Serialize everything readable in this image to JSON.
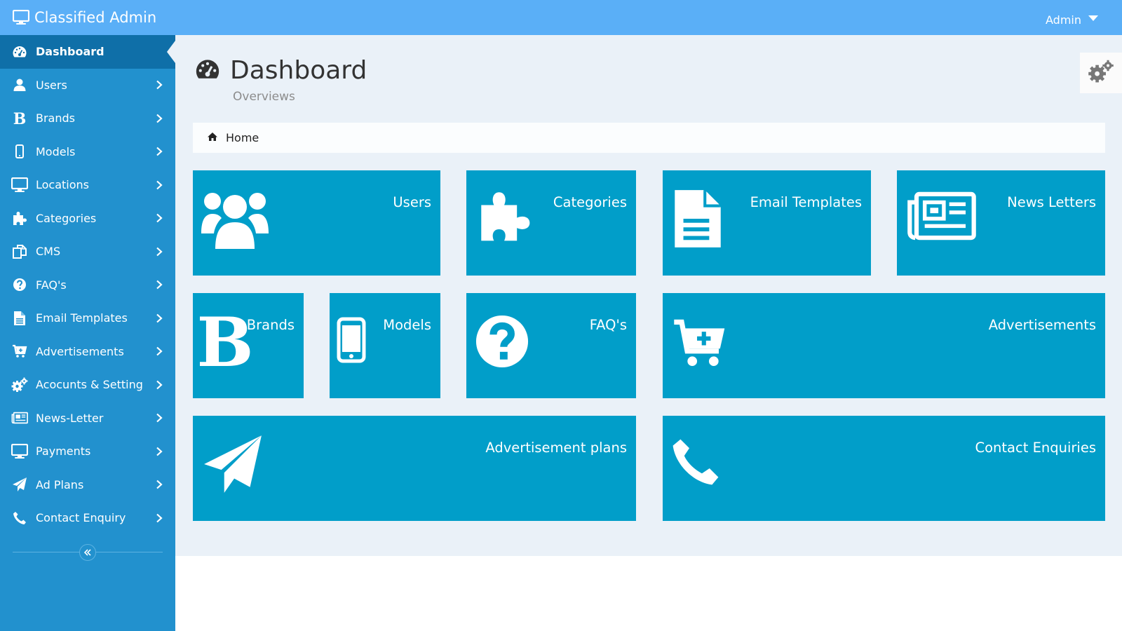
{
  "app": {
    "title": "Classified Admin",
    "user": "Admin"
  },
  "sidebar": {
    "items": [
      {
        "label": "Dashboard",
        "icon": "dashboard-icon",
        "active": true
      },
      {
        "label": "Users",
        "icon": "user-icon"
      },
      {
        "label": "Brands",
        "icon": "brand-b-icon"
      },
      {
        "label": "Models",
        "icon": "mobile-icon"
      },
      {
        "label": "Locations",
        "icon": "monitor-icon"
      },
      {
        "label": "Categories",
        "icon": "puzzle-icon"
      },
      {
        "label": "CMS",
        "icon": "files-icon"
      },
      {
        "label": "FAQ's",
        "icon": "question-icon"
      },
      {
        "label": "Email Templates",
        "icon": "file-text-icon"
      },
      {
        "label": "Advertisements",
        "icon": "cart-plus-icon"
      },
      {
        "label": "Acocunts & Setting",
        "icon": "gears-icon"
      },
      {
        "label": "News-Letter",
        "icon": "newspaper-icon"
      },
      {
        "label": "Payments",
        "icon": "monitor-icon"
      },
      {
        "label": "Ad Plans",
        "icon": "paper-plane-icon"
      },
      {
        "label": "Contact Enquiry",
        "icon": "phone-icon"
      }
    ]
  },
  "page": {
    "title": "Dashboard",
    "subtitle": "Overviews"
  },
  "breadcrumb": {
    "home": "Home"
  },
  "tiles": [
    {
      "label": "Users",
      "icon": "users-group-icon"
    },
    {
      "label": "Categories",
      "icon": "puzzle-icon"
    },
    {
      "label": "Email Templates",
      "icon": "file-text-icon"
    },
    {
      "label": "News Letters",
      "icon": "newspaper-icon"
    },
    {
      "label": "Brands",
      "icon": "brand-b-icon"
    },
    {
      "label": "Models",
      "icon": "mobile-icon"
    },
    {
      "label": "FAQ's",
      "icon": "question-icon"
    },
    {
      "label": "Advertisements",
      "icon": "cart-plus-icon"
    },
    {
      "label": "Advertisement plans",
      "icon": "paper-plane-icon"
    },
    {
      "label": "Contact Enquiries",
      "icon": "phone-icon"
    }
  ],
  "colors": {
    "topbar": "#5aaff7",
    "sidebar": "#2291ce",
    "sidebar_active": "#0f6fa8",
    "content_bg": "#eaf1f8",
    "tile": "#019ec9"
  }
}
